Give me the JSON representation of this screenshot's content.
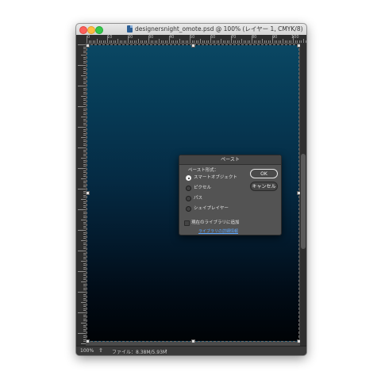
{
  "window": {
    "title": "designersnight_omote.psd @ 100% (レイヤー 1, CMYK/8)"
  },
  "rulers": {
    "top_labels": [
      "0",
      "10",
      "20",
      "30",
      "40",
      "50",
      "60",
      "70",
      "80",
      "90",
      "100"
    ]
  },
  "status": {
    "zoom": "100%",
    "file_info": "ファイル：8.38M/5.93M",
    "arrow": "›"
  },
  "dialog": {
    "title": "ペースト",
    "section_label": "ペースト形式：",
    "options": [
      {
        "label": "スマートオブジェクト",
        "selected": true
      },
      {
        "label": "ピクセル",
        "selected": false
      },
      {
        "label": "パス",
        "selected": false
      },
      {
        "label": "シェイプレイヤー",
        "selected": false
      }
    ],
    "checkbox_label": "現在のライブラリに追加",
    "link_label": "ライブラリの詳細情報",
    "ok_label": "OK",
    "cancel_label": "キャンセル"
  },
  "colors": {
    "canvas_top": "#0a4763",
    "canvas_bottom": "#000306",
    "dialog_bg": "#535353",
    "link": "#5ea8ff"
  }
}
